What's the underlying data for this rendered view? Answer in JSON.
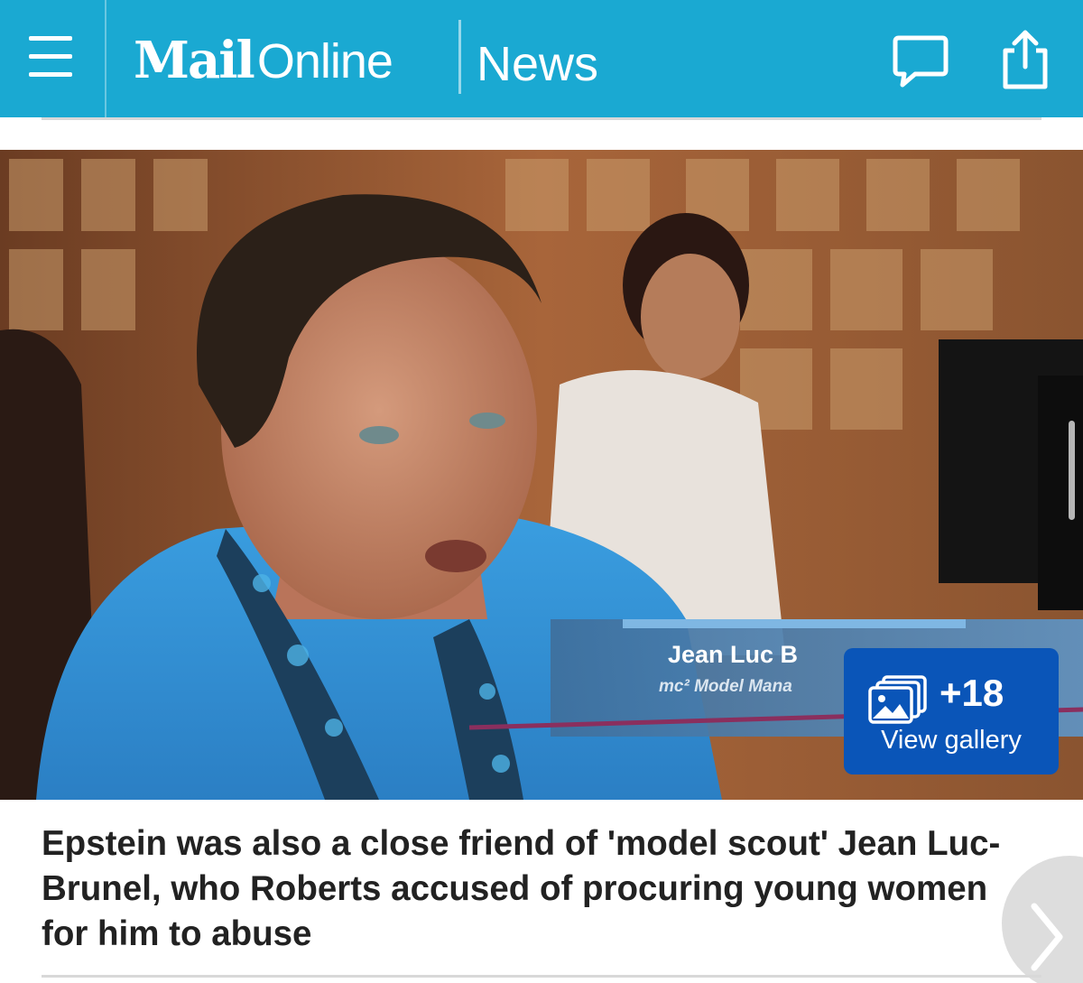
{
  "header": {
    "logo_mail": "Mail",
    "logo_online": "Online",
    "section": "News",
    "background_color": "#1aa9d2",
    "icons": [
      "menu-icon",
      "comments-icon",
      "share-icon"
    ]
  },
  "photo": {
    "lower_third_name": "Jean Luc B",
    "lower_third_title": "mc² Model Mana"
  },
  "gallery": {
    "count": "+18",
    "label": "View gallery",
    "color": "#0a55b8"
  },
  "caption": {
    "text": "Epstein was also a close friend of 'model scout' Jean Luc-Brunel, who Roberts accused of procuring young women for him to abuse"
  }
}
